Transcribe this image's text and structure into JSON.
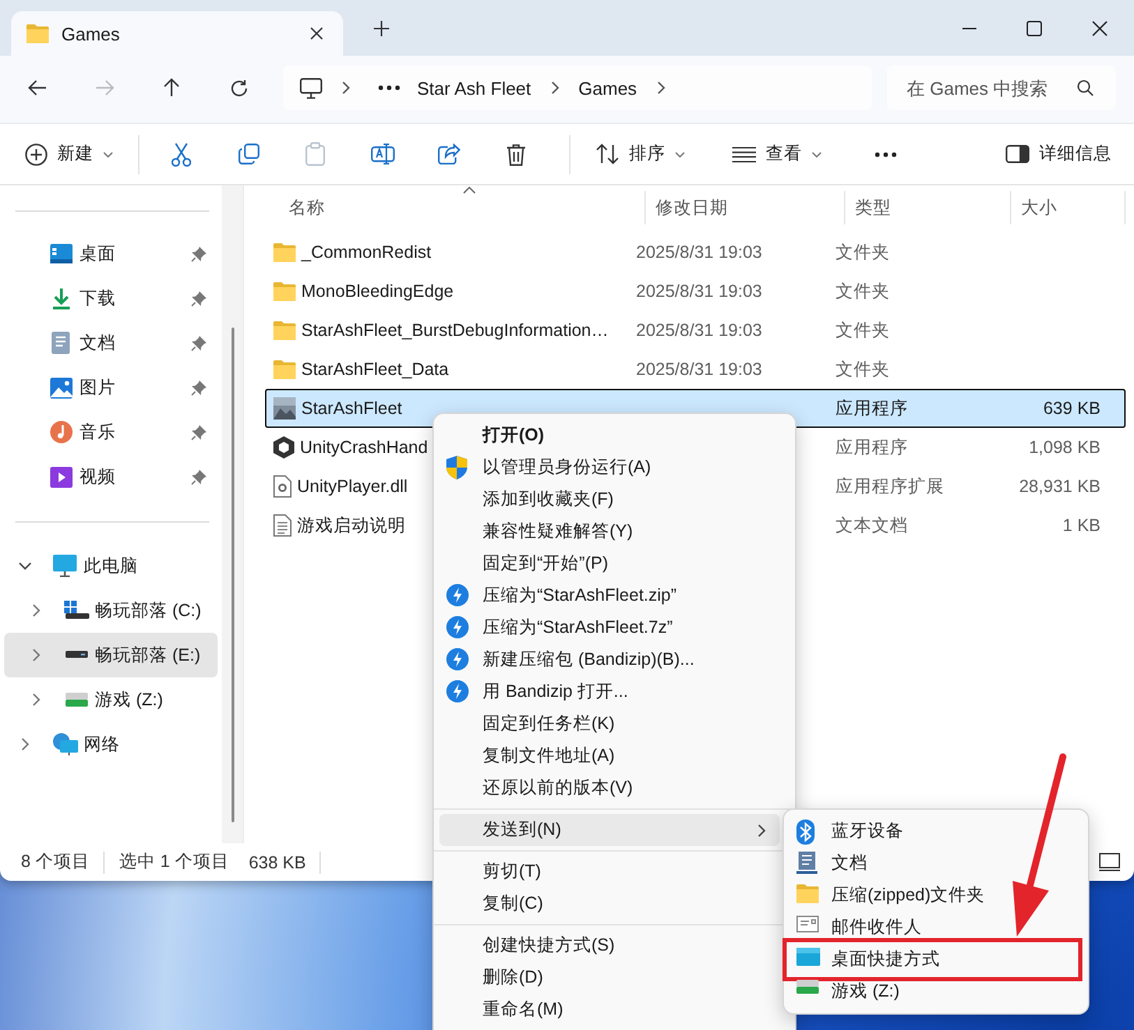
{
  "window": {
    "tab_title": "Games"
  },
  "nav": {
    "buttons": [
      {
        "kind": "back",
        "disabled": false
      },
      {
        "kind": "forward",
        "disabled": true
      },
      {
        "kind": "up",
        "disabled": false
      },
      {
        "kind": "refresh",
        "disabled": false
      }
    ],
    "breadcrumbs": [
      "Star Ash Fleet",
      "Games"
    ],
    "search": {
      "placeholder": "在 Games 中搜索"
    }
  },
  "toolbar": {
    "items": [
      {
        "kind": "new",
        "label": "新建",
        "disabled": false
      },
      {
        "kind": "cut",
        "disabled": false
      },
      {
        "kind": "copy",
        "disabled": false
      },
      {
        "kind": "paste",
        "disabled": true
      },
      {
        "kind": "rename",
        "disabled": false
      },
      {
        "kind": "share",
        "disabled": false
      },
      {
        "kind": "delete",
        "disabled": false
      },
      {
        "kind": "sort",
        "label": "排序",
        "disabled": false
      },
      {
        "kind": "view",
        "label": "查看",
        "disabled": false
      },
      {
        "kind": "more",
        "disabled": false
      }
    ],
    "details": {
      "label": "详细信息"
    }
  },
  "sidebar": {
    "quick_access": [
      {
        "kind": "desktop",
        "label": "桌面",
        "pinned": true,
        "selected": false
      },
      {
        "kind": "download",
        "label": "下载",
        "pinned": true,
        "selected": false
      },
      {
        "kind": "document",
        "label": "文档",
        "pinned": true,
        "selected": false
      },
      {
        "kind": "pictures",
        "label": "图片",
        "pinned": true,
        "selected": false
      },
      {
        "kind": "music",
        "label": "音乐",
        "pinned": true,
        "selected": false
      },
      {
        "kind": "video",
        "label": "视频",
        "pinned": true,
        "selected": false
      }
    ],
    "tree": [
      {
        "kind": "pc",
        "label": "此电脑",
        "expanded": true,
        "selected": false,
        "children": [
          {
            "kind": "system-drive",
            "label": "畅玩部落 (C:)",
            "expanded": false,
            "selected": false
          },
          {
            "kind": "drive",
            "label": "畅玩部落 (E:)",
            "expanded": false,
            "selected": true
          },
          {
            "kind": "game-drive",
            "label": "游戏 (Z:)",
            "expanded": false,
            "selected": false
          }
        ]
      },
      {
        "kind": "network",
        "label": "网络",
        "expanded": false,
        "selected": false
      }
    ]
  },
  "file_list": {
    "columns": [
      {
        "label": "名称",
        "sorted": true
      },
      {
        "label": "修改日期",
        "sorted": false
      },
      {
        "label": "类型",
        "sorted": false
      },
      {
        "label": "大小",
        "sorted": false
      }
    ],
    "rows": [
      {
        "kind": "folder",
        "name": "_CommonRedist",
        "date": "2025/8/31 19:03",
        "type": "文件夹",
        "selected": false
      },
      {
        "kind": "folder",
        "name": "MonoBleedingEdge",
        "date": "2025/8/31 19:03",
        "type": "文件夹",
        "selected": false
      },
      {
        "kind": "folder",
        "name": "StarAshFleet_BurstDebugInformation…",
        "date": "2025/8/31 19:03",
        "type": "文件夹",
        "selected": false
      },
      {
        "kind": "folder",
        "name": "StarAshFleet_Data",
        "date": "2025/8/31 19:03",
        "type": "文件夹",
        "selected": false
      },
      {
        "kind": "app",
        "name": "StarAshFleet",
        "type": "应用程序",
        "size": "639 KB",
        "selected": true
      },
      {
        "kind": "unity",
        "name": "UnityCrashHand",
        "type": "应用程序",
        "size": "1,098 KB",
        "selected": false
      },
      {
        "kind": "dll",
        "name": "UnityPlayer.dll",
        "type": "应用程序扩展",
        "size": "28,931 KB",
        "selected": false
      },
      {
        "kind": "text",
        "name": "游戏启动说明",
        "type": "文本文档",
        "size": "1 KB",
        "selected": false
      }
    ]
  },
  "status_bar": {
    "item_count": "8 个项目",
    "selection": "选中 1 个项目",
    "selection_size": "638 KB"
  },
  "context_menu": {
    "groups": [
      [
        {
          "kind": "plain",
          "label": "打开(O)",
          "default": true,
          "submenu": false,
          "selected": false
        },
        {
          "kind": "shield",
          "label": "以管理员身份运行(A)",
          "default": false,
          "submenu": false,
          "selected": false
        },
        {
          "kind": "plain",
          "label": "添加到收藏夹(F)",
          "default": false,
          "submenu": false,
          "selected": false
        },
        {
          "kind": "plain",
          "label": "兼容性疑难解答(Y)",
          "default": false,
          "submenu": false,
          "selected": false
        },
        {
          "kind": "plain",
          "label": "固定到“开始”(P)",
          "default": false,
          "submenu": false,
          "selected": false
        },
        {
          "kind": "bandizip",
          "label": "压缩为“StarAshFleet.zip”",
          "default": false,
          "submenu": false,
          "selected": false
        },
        {
          "kind": "bandizip",
          "label": "压缩为“StarAshFleet.7z”",
          "default": false,
          "submenu": false,
          "selected": false
        },
        {
          "kind": "bandizip",
          "label": "新建压缩包 (Bandizip)(B)...",
          "default": false,
          "submenu": false,
          "selected": false
        },
        {
          "kind": "bandizip",
          "label": "用 Bandizip 打开...",
          "default": false,
          "submenu": false,
          "selected": false
        },
        {
          "kind": "plain",
          "label": "固定到任务栏(K)",
          "default": false,
          "submenu": false,
          "selected": false
        },
        {
          "kind": "plain",
          "label": "复制文件地址(A)",
          "default": false,
          "submenu": false,
          "selected": false
        },
        {
          "kind": "plain",
          "label": "还原以前的版本(V)",
          "default": false,
          "submenu": false,
          "selected": false
        }
      ],
      [
        {
          "kind": "plain",
          "label": "发送到(N)",
          "default": false,
          "submenu": true,
          "selected": true
        }
      ],
      [
        {
          "kind": "plain",
          "label": "剪切(T)",
          "default": false,
          "submenu": false,
          "selected": false
        },
        {
          "kind": "plain",
          "label": "复制(C)",
          "default": false,
          "submenu": false,
          "selected": false
        }
      ],
      [
        {
          "kind": "plain",
          "label": "创建快捷方式(S)",
          "default": false,
          "submenu": false,
          "selected": false
        },
        {
          "kind": "plain",
          "label": "删除(D)",
          "default": false,
          "submenu": false,
          "selected": false
        },
        {
          "kind": "plain",
          "label": "重命名(M)",
          "default": false,
          "submenu": false,
          "selected": false
        }
      ]
    ]
  },
  "send_to_menu": {
    "items": [
      {
        "kind": "bluetooth",
        "label": "蓝牙设备",
        "marked": false
      },
      {
        "kind": "document",
        "label": "文档",
        "marked": false
      },
      {
        "kind": "zip-folder",
        "label": "压缩(zipped)文件夹",
        "marked": false
      },
      {
        "kind": "mail",
        "label": "邮件收件人",
        "marked": false
      },
      {
        "kind": "desktop",
        "label": "桌面快捷方式",
        "marked": true
      },
      {
        "kind": "game-drive",
        "label": "游戏 (Z:)",
        "marked": false
      }
    ]
  }
}
